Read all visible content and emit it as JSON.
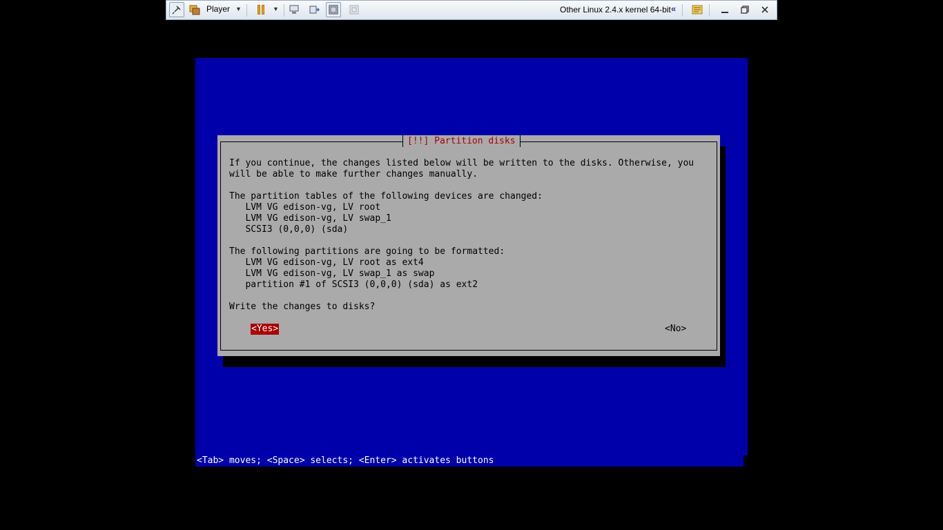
{
  "toolbar": {
    "player_label": "Player",
    "vm_title": "Other Linux 2.4.x kernel 64-bit",
    "icons": [
      "pin-icon",
      "player-menu-icon",
      "pause-icon",
      "send-ctrl-alt-del-icon",
      "removable-devices-icon",
      "fit-window-icon",
      "unity-icon",
      "collapse-icon",
      "message-log-icon",
      "minimize-icon",
      "restore-icon",
      "close-icon"
    ]
  },
  "dialog": {
    "title": "[!!] Partition disks",
    "lines": [
      "If you continue, the changes listed below will be written to the disks. Otherwise, you",
      "will be able to make further changes manually.",
      "",
      "The partition tables of the following devices are changed:",
      "   LVM VG edison-vg, LV root",
      "   LVM VG edison-vg, LV swap_1",
      "   SCSI3 (0,0,0) (sda)",
      "",
      "The following partitions are going to be formatted:",
      "   LVM VG edison-vg, LV root as ext4",
      "   LVM VG edison-vg, LV swap_1 as swap",
      "   partition #1 of SCSI3 (0,0,0) (sda) as ext2",
      "",
      "Write the changes to disks?"
    ],
    "yes_label": "<Yes>",
    "no_label": "<No>"
  },
  "statusbar": {
    "text": "<Tab> moves; <Space> selects; <Enter> activates buttons"
  },
  "colors": {
    "console_bg": "#0000aa",
    "dialog_bg": "#aaaaaa",
    "title_red": "#aa0000",
    "selected_button_bg": "#aa0000"
  }
}
